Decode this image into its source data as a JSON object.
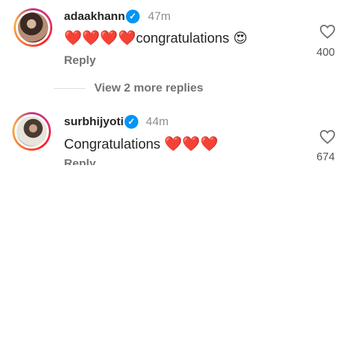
{
  "comments": [
    {
      "username": "adaakhann",
      "time": "47m",
      "text": "congratulations",
      "prefix_emoji": "❤️❤️❤️❤️",
      "suffix_emoji": "😍",
      "reply_label": "Reply",
      "likes": "400",
      "verified": true
    },
    {
      "username": "surbhijyoti",
      "time": "44m",
      "text": "Congratulations",
      "suffix_emoji": "❤️❤️❤️",
      "reply_label": "Reply",
      "likes": "674",
      "verified": true
    }
  ],
  "view_more": "View 2 more replies",
  "icons": {
    "verified": "verified-badge-icon",
    "like": "heart-outline-icon"
  },
  "colors": {
    "verified": "#0095f6",
    "heart": "#e5142b",
    "ring_accent": "#e1306c"
  }
}
